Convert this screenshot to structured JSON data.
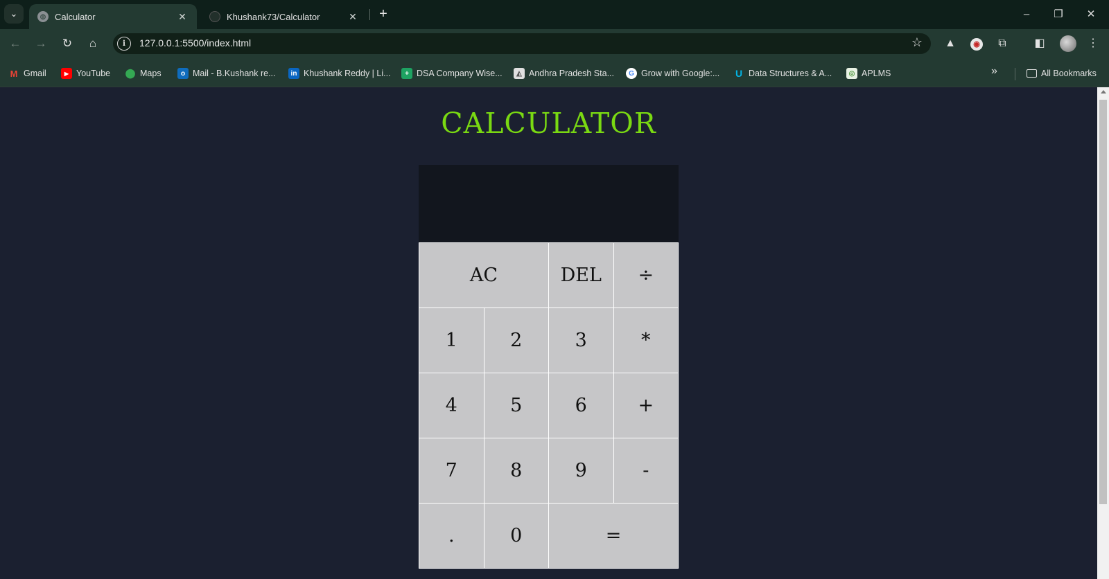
{
  "browser": {
    "tabs": [
      {
        "title": "Calculator",
        "active": true
      },
      {
        "title": "Khushank73/Calculator",
        "active": false
      }
    ],
    "url": "127.0.0.1:5500/index.html",
    "bookmarks": [
      {
        "label": "Gmail",
        "icon": "gmail-icon",
        "color": "#ea4335"
      },
      {
        "label": "YouTube",
        "icon": "youtube-icon",
        "color": "#ff0000"
      },
      {
        "label": "Maps",
        "icon": "maps-icon",
        "color": "#34a853"
      },
      {
        "label": "Mail - B.Kushank re...",
        "icon": "outlook-icon",
        "color": "#0f6cbd"
      },
      {
        "label": "Khushank Reddy | Li...",
        "icon": "linkedin-icon",
        "color": "#0a66c2"
      },
      {
        "label": "DSA Company Wise...",
        "icon": "sheets-icon",
        "color": "#1ea362"
      },
      {
        "label": "Andhra Pradesh Sta...",
        "icon": "image-icon",
        "color": "#d0d0d0"
      },
      {
        "label": "Grow with Google:...",
        "icon": "google-icon",
        "color": "#4285f4"
      },
      {
        "label": "Data Structures & A...",
        "icon": "udacity-icon",
        "color": "#02b3e4"
      },
      {
        "label": "APLMS",
        "icon": "aplms-icon",
        "color": "#5a9e4b"
      }
    ],
    "all_bookmarks_label": "All Bookmarks"
  },
  "calculator": {
    "title": "CALCULATOR",
    "display_value": "",
    "keys": [
      {
        "label": "AC",
        "name": "ac-button",
        "wide": true
      },
      {
        "label": "DEL",
        "name": "del-button",
        "wide": false
      },
      {
        "label": "÷",
        "name": "divide-button",
        "wide": false
      },
      {
        "label": "1",
        "name": "digit-1-button",
        "wide": false
      },
      {
        "label": "2",
        "name": "digit-2-button",
        "wide": false
      },
      {
        "label": "3",
        "name": "digit-3-button",
        "wide": false
      },
      {
        "label": "*",
        "name": "multiply-button",
        "wide": false
      },
      {
        "label": "4",
        "name": "digit-4-button",
        "wide": false
      },
      {
        "label": "5",
        "name": "digit-5-button",
        "wide": false
      },
      {
        "label": "6",
        "name": "digit-6-button",
        "wide": false
      },
      {
        "label": "+",
        "name": "add-button",
        "wide": false
      },
      {
        "label": "7",
        "name": "digit-7-button",
        "wide": false
      },
      {
        "label": "8",
        "name": "digit-8-button",
        "wide": false
      },
      {
        "label": "9",
        "name": "digit-9-button",
        "wide": false
      },
      {
        "label": "-",
        "name": "subtract-button",
        "wide": false
      },
      {
        "label": ".",
        "name": "decimal-button",
        "wide": false
      },
      {
        "label": "0",
        "name": "digit-0-button",
        "wide": false
      },
      {
        "label": "=",
        "name": "equals-button",
        "wide": true
      }
    ]
  },
  "colors": {
    "title_green": "#7ad912",
    "page_bg": "#1b2030",
    "key_bg": "#c6c6c8",
    "display_bg": "#12161e"
  }
}
